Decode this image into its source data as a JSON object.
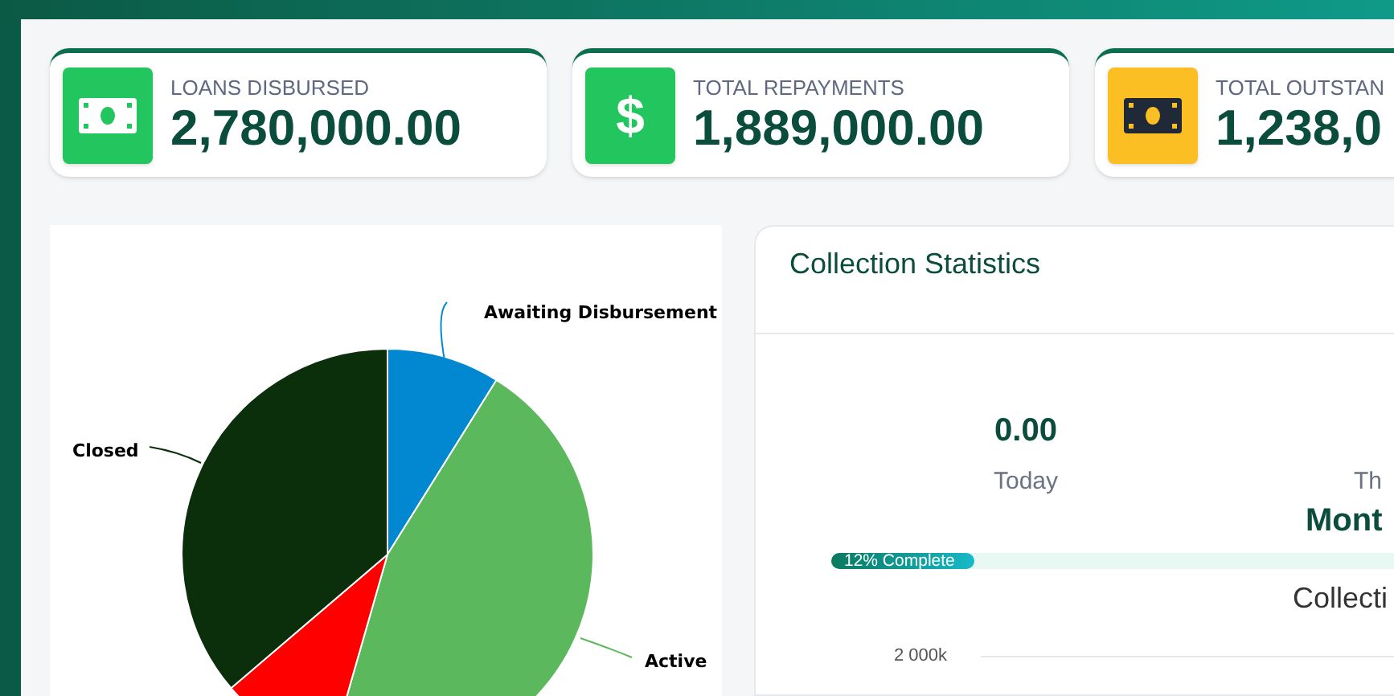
{
  "stat_cards": [
    {
      "kind": "cash",
      "color": "#22c55e",
      "label": "LOANS DISBURSED",
      "value": "2,780,000.00"
    },
    {
      "kind": "glyph",
      "glyph": "$",
      "color": "#22c55e",
      "label": "TOTAL REPAYMENTS",
      "value": "1,889,000.00"
    },
    {
      "kind": "cash",
      "color": "#fbbf24",
      "label": "TOTAL OUTSTAN",
      "value": "1,238,0"
    }
  ],
  "pie": {
    "slices": [
      {
        "label": "Awaiting Disbursement",
        "color": "#0288d1"
      },
      {
        "label": "Active",
        "color": "#5cb85c"
      },
      {
        "color": "#ff0000"
      },
      {
        "label": "Closed",
        "color": "#0b2e0b"
      }
    ]
  },
  "collection_statistics": {
    "title": "Collection Statistics",
    "today": {
      "value": "0.00",
      "label": "Today"
    },
    "month": {
      "label": "Th",
      "value": "Mont"
    },
    "progress": {
      "level": 0.12,
      "text": "12% Complete"
    },
    "chart_title": "Collecti",
    "y_tick": "2 000k"
  }
}
